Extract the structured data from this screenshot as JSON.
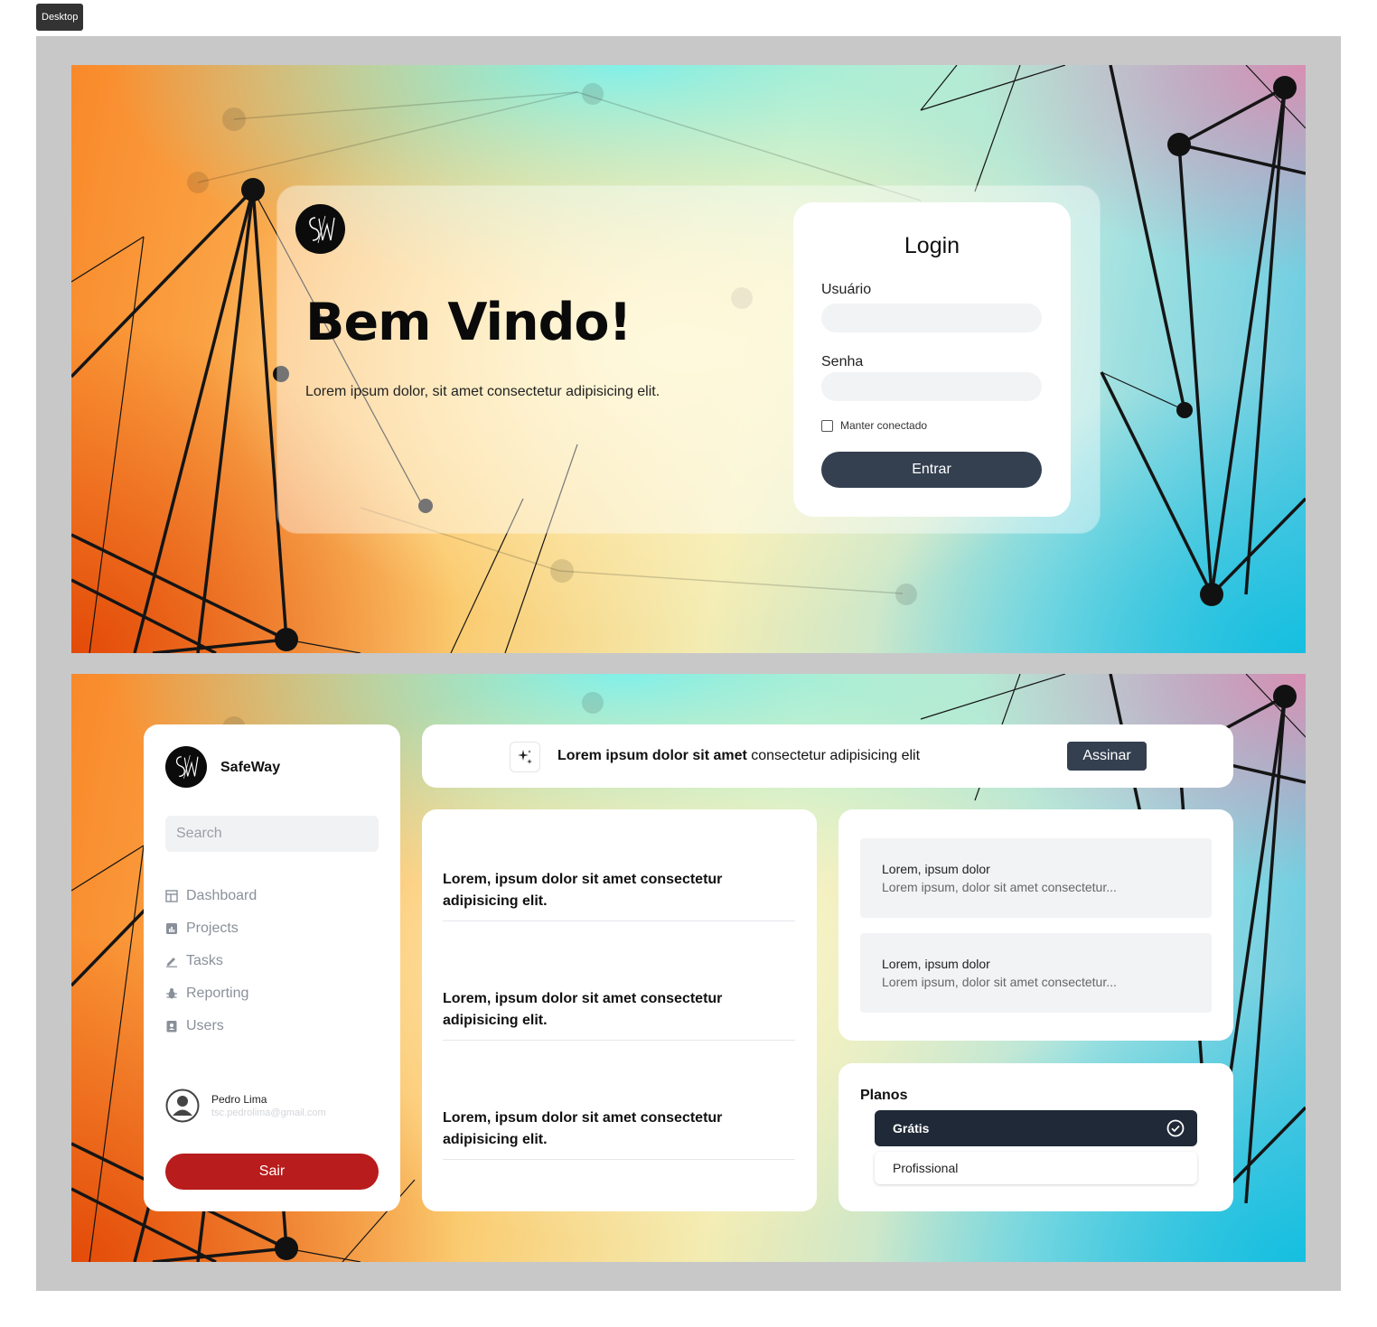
{
  "device_label": "Desktop",
  "login_page": {
    "welcome_title": "Bem Vindo!",
    "welcome_subtitle": "Lorem ipsum dolor, sit amet consectetur adipisicing elit.",
    "login": {
      "title": "Login",
      "username_label": "Usuário",
      "username_value": "",
      "password_label": "Senha",
      "password_value": "",
      "remember_label": "Manter conectado",
      "remember_checked": false,
      "submit_label": "Entrar"
    }
  },
  "dashboard": {
    "brand": "SafeWay",
    "search_placeholder": "Search",
    "nav": [
      {
        "label": "Dashboard",
        "icon": "table-icon"
      },
      {
        "label": "Projects",
        "icon": "chart-icon"
      },
      {
        "label": "Tasks",
        "icon": "pencil-icon"
      },
      {
        "label": "Reporting",
        "icon": "bug-icon"
      },
      {
        "label": "Users",
        "icon": "id-badge-icon"
      }
    ],
    "user": {
      "name": "Pedro Lima",
      "email": "tsc.pedrolima@gmail.com"
    },
    "logout_label": "Sair",
    "banner": {
      "bold_text": "Lorem ipsum dolor sit amet",
      "text": " consectetur adipisicing elit",
      "button_label": "Assinar"
    },
    "feed": [
      "Lorem, ipsum dolor sit amet consectetur adipisicing elit.",
      "Lorem, ipsum dolor sit amet consectetur adipisicing elit.",
      "Lorem, ipsum dolor sit amet consectetur adipisicing elit."
    ],
    "messages": [
      {
        "title": "Lorem, ipsum dolor",
        "body": "Lorem ipsum, dolor sit amet consectetur..."
      },
      {
        "title": "Lorem, ipsum dolor",
        "body": "Lorem ipsum, dolor sit amet consectetur..."
      }
    ],
    "plans": {
      "title": "Planos",
      "options": [
        {
          "label": "Grátis",
          "selected": true
        },
        {
          "label": "Profissional",
          "selected": false
        }
      ]
    }
  },
  "colors": {
    "primary_button": "#344050",
    "selected_plan": "#1f2937",
    "logout": "#b91c1c"
  }
}
